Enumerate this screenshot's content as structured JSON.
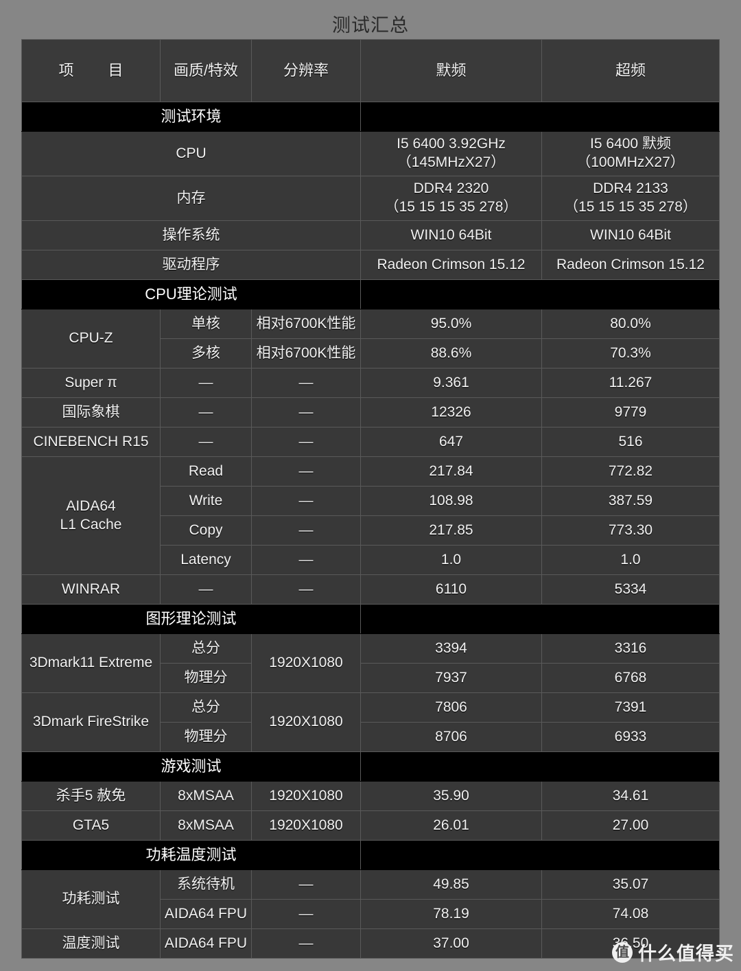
{
  "title": "测试汇总",
  "columns": {
    "item": "项　目",
    "quality": "画质/特效",
    "resolution": "分辨率",
    "stock": "默频",
    "oc": "超频"
  },
  "sections": {
    "env": "测试环境",
    "cpu_theory": "CPU理论测试",
    "gfx_theory": "图形理论测试",
    "game": "游戏测试",
    "power_temp": "功耗温度测试"
  },
  "env_rows": [
    {
      "item": "CPU",
      "stock_l1": "I5 6400 3.92GHz",
      "stock_l2": "（145MHzX27）",
      "oc_l1": "I5 6400 默频",
      "oc_l2": "（100MHzX27）"
    },
    {
      "item": "内存",
      "stock_l1": "DDR4 2320",
      "stock_l2": "（15 15 15 35 278）",
      "oc_l1": "DDR4 2133",
      "oc_l2": "（15 15 15 35 278）"
    },
    {
      "item": "操作系统",
      "stock_l1": "WIN10 64Bit",
      "stock_l2": "",
      "oc_l1": "WIN10 64Bit",
      "oc_l2": ""
    },
    {
      "item": "驱动程序",
      "stock_l1": "Radeon Crimson 15.12",
      "stock_l2": "",
      "oc_l1": "Radeon Crimson 15.12",
      "oc_l2": ""
    }
  ],
  "cpu_rows": {
    "cpuz_label": "CPU-Z",
    "cpuz_single": "单核",
    "cpuz_multi": "多核",
    "cpuz_single_res": "相对6700K性能",
    "cpuz_multi_res": "相对6700K性能",
    "cpuz_single_stock": "95.0%",
    "cpuz_single_oc": "80.0%",
    "cpuz_multi_stock": "88.6%",
    "cpuz_multi_oc": "70.3%",
    "superpi_label": "Super π",
    "superpi_quality": "—",
    "superpi_res": "—",
    "superpi_stock": "9.361",
    "superpi_oc": "11.267",
    "chess_label": "国际象棋",
    "chess_quality": "—",
    "chess_res": "—",
    "chess_stock": "12326",
    "chess_oc": "9779",
    "cinebench_label": "CINEBENCH R15",
    "cinebench_quality": "—",
    "cinebench_res": "—",
    "cinebench_stock": "647",
    "cinebench_oc": "516",
    "aida_label_l1": "AIDA64",
    "aida_label_l2": "L1 Cache",
    "aida_read": "Read",
    "aida_read_res": "—",
    "aida_read_stock": "217.84",
    "aida_read_oc": "772.82",
    "aida_write": "Write",
    "aida_write_res": "—",
    "aida_write_stock": "108.98",
    "aida_write_oc": "387.59",
    "aida_copy": "Copy",
    "aida_copy_res": "—",
    "aida_copy_stock": "217.85",
    "aida_copy_oc": "773.30",
    "aida_latency": "Latency",
    "aida_latency_res": "—",
    "aida_latency_stock": "1.0",
    "aida_latency_oc": "1.0",
    "winrar_label": "WINRAR",
    "winrar_quality": "—",
    "winrar_res": "—",
    "winrar_stock": "6110",
    "winrar_oc": "5334"
  },
  "gfx_rows": {
    "dm11_label": "3Dmark11 Extreme",
    "dm11_res": "1920X1080",
    "dm11_total_label": "总分",
    "dm11_total_stock": "3394",
    "dm11_total_oc": "3316",
    "dm11_phys_label": "物理分",
    "dm11_phys_stock": "7937",
    "dm11_phys_oc": "6768",
    "fs_label": "3Dmark FireStrike",
    "fs_res": "1920X1080",
    "fs_total_label": "总分",
    "fs_total_stock": "7806",
    "fs_total_oc": "7391",
    "fs_phys_label": "物理分",
    "fs_phys_stock": "8706",
    "fs_phys_oc": "6933"
  },
  "game_rows": [
    {
      "item": "杀手5 赦免",
      "quality": "8xMSAA",
      "resolution": "1920X1080",
      "stock": "35.90",
      "oc": "34.61"
    },
    {
      "item": "GTA5",
      "quality": "8xMSAA",
      "resolution": "1920X1080",
      "stock": "26.01",
      "oc": "27.00"
    }
  ],
  "power_rows": {
    "power_label": "功耗测试",
    "idle_label": "系统待机",
    "idle_res": "—",
    "idle_stock": "49.85",
    "idle_oc": "35.07",
    "fpu_label": "AIDA64 FPU",
    "fpu_res": "—",
    "fpu_stock": "78.19",
    "fpu_oc": "74.08",
    "temp_label": "温度测试",
    "temp_quality": "AIDA64 FPU",
    "temp_res": "—",
    "temp_stock": "37.00",
    "temp_oc": "36.50"
  },
  "watermark": {
    "badge": "值",
    "text": "什么值得买"
  },
  "chart_data": {
    "type": "table",
    "title": "测试汇总",
    "columns": [
      "项　目",
      "画质/特效",
      "分辨率",
      "默频",
      "超频"
    ],
    "rows": [
      [
        "测试环境",
        "",
        "",
        "",
        ""
      ],
      [
        "CPU",
        "",
        "",
        "I5 6400 3.92GHz（145MHzX27）",
        "I5 6400 默频（100MHzX27）"
      ],
      [
        "内存",
        "",
        "",
        "DDR4 2320（15 15 15 35 278）",
        "DDR4 2133（15 15 15 35 278）"
      ],
      [
        "操作系统",
        "",
        "",
        "WIN10 64Bit",
        "WIN10 64Bit"
      ],
      [
        "驱动程序",
        "",
        "",
        "Radeon Crimson 15.12",
        "Radeon Crimson 15.12"
      ],
      [
        "CPU理论测试",
        "",
        "",
        "",
        ""
      ],
      [
        "CPU-Z",
        "单核",
        "相对6700K性能",
        "95.0%",
        "80.0%"
      ],
      [
        "CPU-Z",
        "多核",
        "相对6700K性能",
        "88.6%",
        "70.3%"
      ],
      [
        "Super π",
        "—",
        "—",
        "9.361",
        "11.267"
      ],
      [
        "国际象棋",
        "—",
        "—",
        "12326",
        "9779"
      ],
      [
        "CINEBENCH R15",
        "—",
        "—",
        "647",
        "516"
      ],
      [
        "AIDA64 L1 Cache",
        "Read",
        "—",
        "217.84",
        "772.82"
      ],
      [
        "AIDA64 L1 Cache",
        "Write",
        "—",
        "108.98",
        "387.59"
      ],
      [
        "AIDA64 L1 Cache",
        "Copy",
        "—",
        "217.85",
        "773.30"
      ],
      [
        "AIDA64 L1 Cache",
        "Latency",
        "—",
        "1.0",
        "1.0"
      ],
      [
        "WINRAR",
        "—",
        "—",
        "6110",
        "5334"
      ],
      [
        "图形理论测试",
        "",
        "",
        "",
        ""
      ],
      [
        "3Dmark11 Extreme",
        "总分",
        "1920X1080",
        "3394",
        "3316"
      ],
      [
        "3Dmark11 Extreme",
        "物理分",
        "1920X1080",
        "7937",
        "6768"
      ],
      [
        "3Dmark FireStrike",
        "总分",
        "1920X1080",
        "7806",
        "7391"
      ],
      [
        "3Dmark FireStrike",
        "物理分",
        "1920X1080",
        "8706",
        "6933"
      ],
      [
        "游戏测试",
        "",
        "",
        "",
        ""
      ],
      [
        "杀手5 赦免",
        "8xMSAA",
        "1920X1080",
        "35.90",
        "34.61"
      ],
      [
        "GTA5",
        "8xMSAA",
        "1920X1080",
        "26.01",
        "27.00"
      ],
      [
        "功耗温度测试",
        "",
        "",
        "",
        ""
      ],
      [
        "功耗测试",
        "系统待机",
        "—",
        "49.85",
        "35.07"
      ],
      [
        "功耗测试",
        "AIDA64 FPU",
        "—",
        "78.19",
        "74.08"
      ],
      [
        "温度测试",
        "AIDA64 FPU",
        "—",
        "37.00",
        "36.50"
      ]
    ]
  }
}
